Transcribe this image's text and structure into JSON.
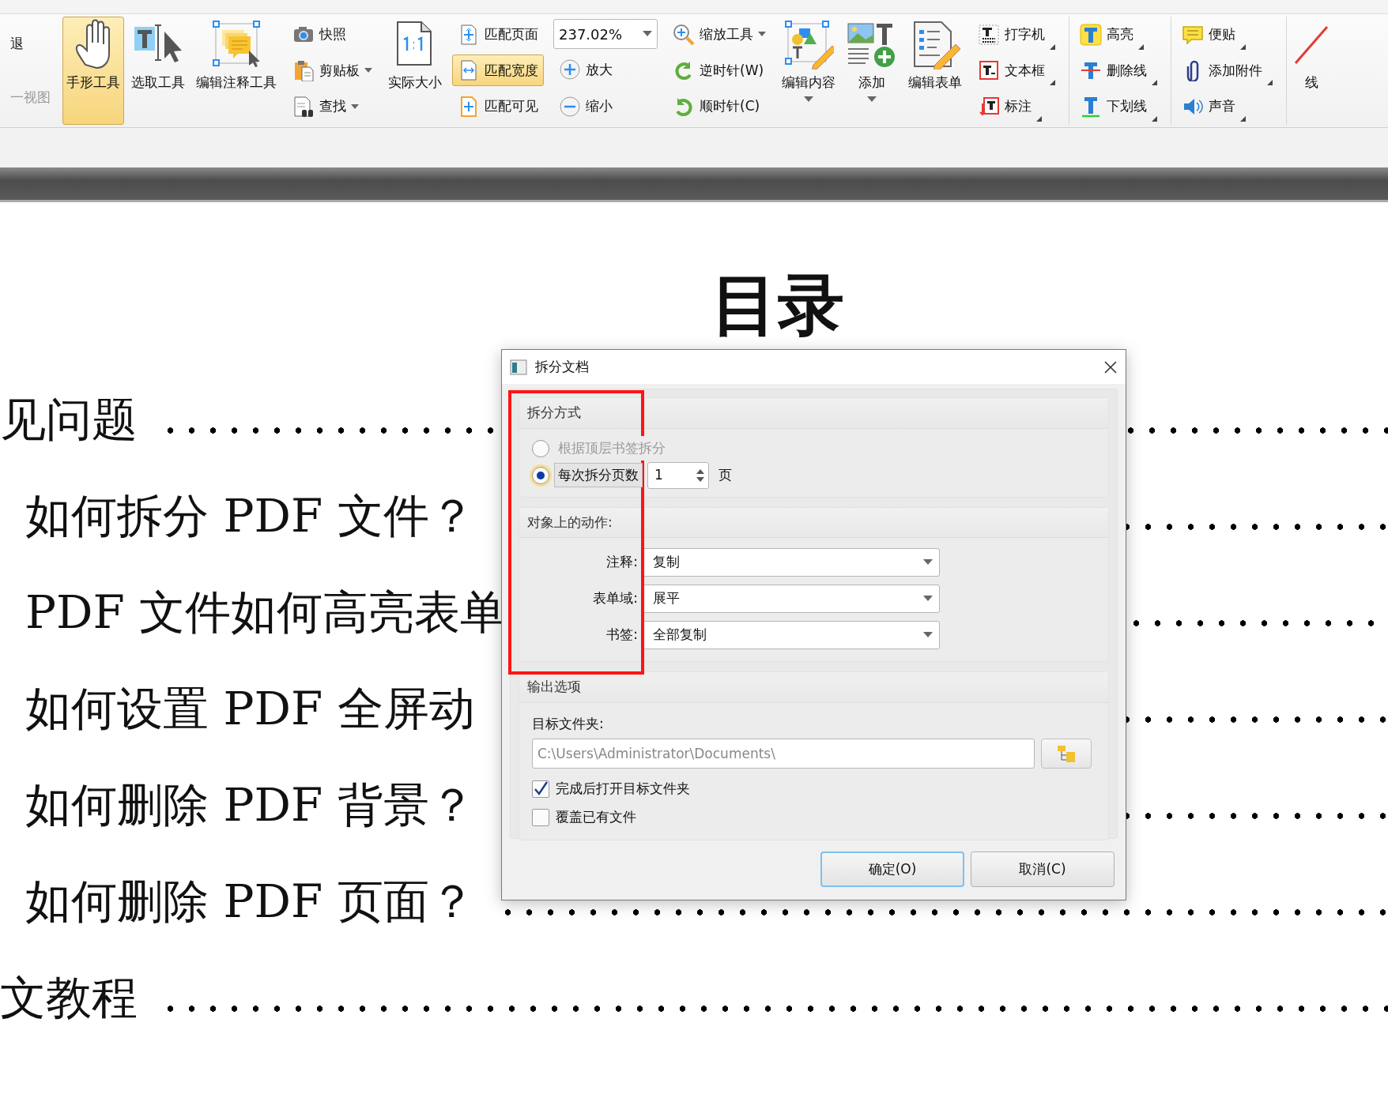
{
  "ribbon": [
    {
      "kind": "stack",
      "items": [
        {
          "label": "退",
          "disabled": false
        },
        {
          "label": "一视图",
          "disabled": true
        }
      ]
    },
    {
      "kind": "big",
      "label": "手形工具",
      "selected": true
    },
    {
      "kind": "big",
      "label": "选取工具",
      "selected": false
    },
    {
      "kind": "big",
      "label": "编辑注释工具",
      "selected": false
    },
    {
      "kind": "stack",
      "items": [
        {
          "label": "快照"
        },
        {
          "label": "剪贴板",
          "dropdown": true
        },
        {
          "label": "查找",
          "dropdown": true
        }
      ]
    },
    {
      "kind": "big",
      "label": "实际大小",
      "selected": false
    },
    {
      "kind": "stack",
      "items": [
        {
          "label": "匹配页面",
          "selected": false
        },
        {
          "label": "匹配宽度",
          "selected": true
        },
        {
          "label": "匹配可见",
          "selected": false
        }
      ]
    },
    {
      "kind": "stack",
      "items": [
        {
          "kind": "combo",
          "value": "237.02%"
        },
        {
          "label": "放大"
        },
        {
          "label": "缩小"
        }
      ]
    },
    {
      "kind": "stack",
      "items": [
        {
          "label": "缩放工具",
          "dropdown": true
        },
        {
          "label": "逆时针(W)"
        },
        {
          "label": "顺时针(C)"
        }
      ]
    },
    {
      "kind": "big",
      "label": "编辑内容",
      "dropdown": true
    },
    {
      "kind": "big",
      "label": "添加",
      "dropdown": true
    },
    {
      "kind": "big",
      "label": "编辑表单"
    },
    {
      "kind": "stack",
      "items": [
        {
          "label": "打字机",
          "more": true
        },
        {
          "label": "文本框",
          "more": true
        },
        {
          "label": "标注",
          "more": true
        }
      ]
    },
    {
      "kind": "stack",
      "separated": true,
      "items": [
        {
          "label": "高亮",
          "more": true
        },
        {
          "label": "删除线",
          "more": true
        },
        {
          "label": "下划线",
          "more": true
        }
      ]
    },
    {
      "kind": "stack",
      "separated": true,
      "items": [
        {
          "label": "便贴",
          "more": true
        },
        {
          "label": "添加附件",
          "more": true
        },
        {
          "label": "声音",
          "more": true
        }
      ]
    },
    {
      "kind": "big",
      "label": "线",
      "separated": true
    }
  ],
  "document": {
    "title": "目录",
    "entries": [
      {
        "text": "见问题",
        "indented": false
      },
      {
        "text": "如何拆分 PDF 文件？",
        "indented": true
      },
      {
        "text": "PDF 文件如何高亮表单",
        "indented": true
      },
      {
        "text": "如何设置 PDF 全屏动",
        "indented": true
      },
      {
        "text": "如何删除 PDF 背景？",
        "indented": true
      },
      {
        "text": "如何删除 PDF 页面？",
        "indented": true
      },
      {
        "text": "文教程",
        "indented": false
      }
    ]
  },
  "dialog": {
    "title": "拆分文档",
    "split_method": {
      "heading": "拆分方式",
      "options": [
        {
          "label": "根据顶层书签拆分",
          "selected": false,
          "disabled": true
        },
        {
          "label": "每次拆分页数",
          "selected": true,
          "disabled": false
        }
      ],
      "pages_value": "1",
      "pages_unit": "页"
    },
    "actions": {
      "heading": "对象上的动作:",
      "fields": [
        {
          "label": "注释:",
          "value": "复制"
        },
        {
          "label": "表单域:",
          "value": "展平"
        },
        {
          "label": "书签:",
          "value": "全部复制"
        }
      ]
    },
    "output": {
      "heading": "输出选项",
      "folder_label": "目标文件夹:",
      "folder_path": "C:\\Users\\Administrator\\Documents\\",
      "checkboxes": [
        {
          "label": "完成后打开目标文件夹",
          "checked": true
        },
        {
          "label": "覆盖已有文件",
          "checked": false
        }
      ]
    },
    "buttons": [
      {
        "label": "确定(O)",
        "default": true
      },
      {
        "label": "取消(C)",
        "default": false
      }
    ]
  }
}
